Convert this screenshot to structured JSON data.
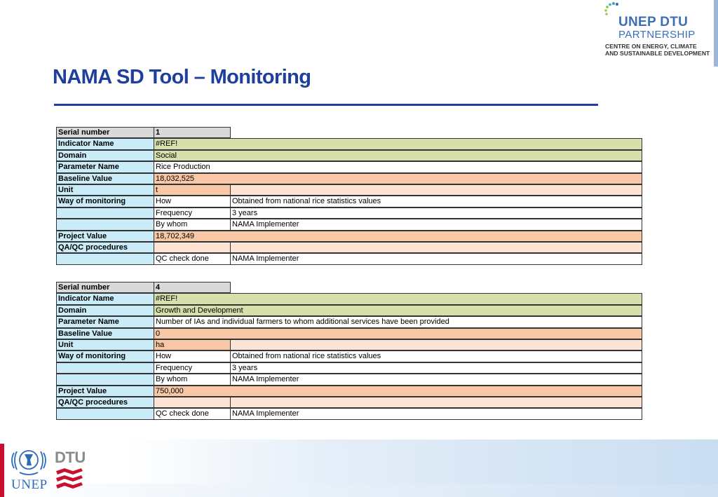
{
  "header": {
    "logo_line1": "UNEP DTU",
    "logo_line2": "PARTNERSHIP",
    "logo_line3": "CENTRE ON ENERGY, CLIMATE",
    "logo_line4": "AND SUSTAINABLE DEVELOPMENT"
  },
  "title": "NAMA SD Tool – Monitoring",
  "labels": {
    "serial": "Serial number",
    "indicator": "Indicator Name",
    "domain": "Domain",
    "parameter": "Parameter Name",
    "baseline": "Baseline Value",
    "unit": "Unit",
    "way": "Way of monitoring",
    "project": "Project Value",
    "qaqc": "QA/QC procedures"
  },
  "sublabels": {
    "how": "How",
    "frequency": "Frequency",
    "by_whom": "By whom",
    "qc_check": "QC check done"
  },
  "indicators": [
    {
      "serial": "1",
      "indicator_name": "#REF!",
      "domain": "Social",
      "parameter": "Rice Production",
      "baseline": "18,032,525",
      "unit": "t",
      "how": "Obtained from national rice statistics values",
      "frequency": "3 years",
      "by_whom": "NAMA Implementer",
      "project_value": "18,702,349",
      "qc_check": "NAMA Implementer"
    },
    {
      "serial": "4",
      "indicator_name": "#REF!",
      "domain": "Growth and Development",
      "parameter": "Number of IAs and individual farmers to whom additional services have been provided",
      "baseline": "0",
      "unit": "ha",
      "how": "Obtained from national rice statistics values",
      "frequency": "3 years",
      "by_whom": "NAMA Implementer",
      "project_value": "750,000",
      "qc_check": "NAMA Implementer"
    }
  ],
  "footer": {
    "unep": "UNEP",
    "dtu": "DTU"
  },
  "colors": {
    "title_blue": "#1f3f9e",
    "label_cyan": "#c9ecf8",
    "green": "#d5e0ad",
    "orange": "#f8c7a6",
    "light_orange": "#fde3d3",
    "grey": "#d9d9d9"
  }
}
